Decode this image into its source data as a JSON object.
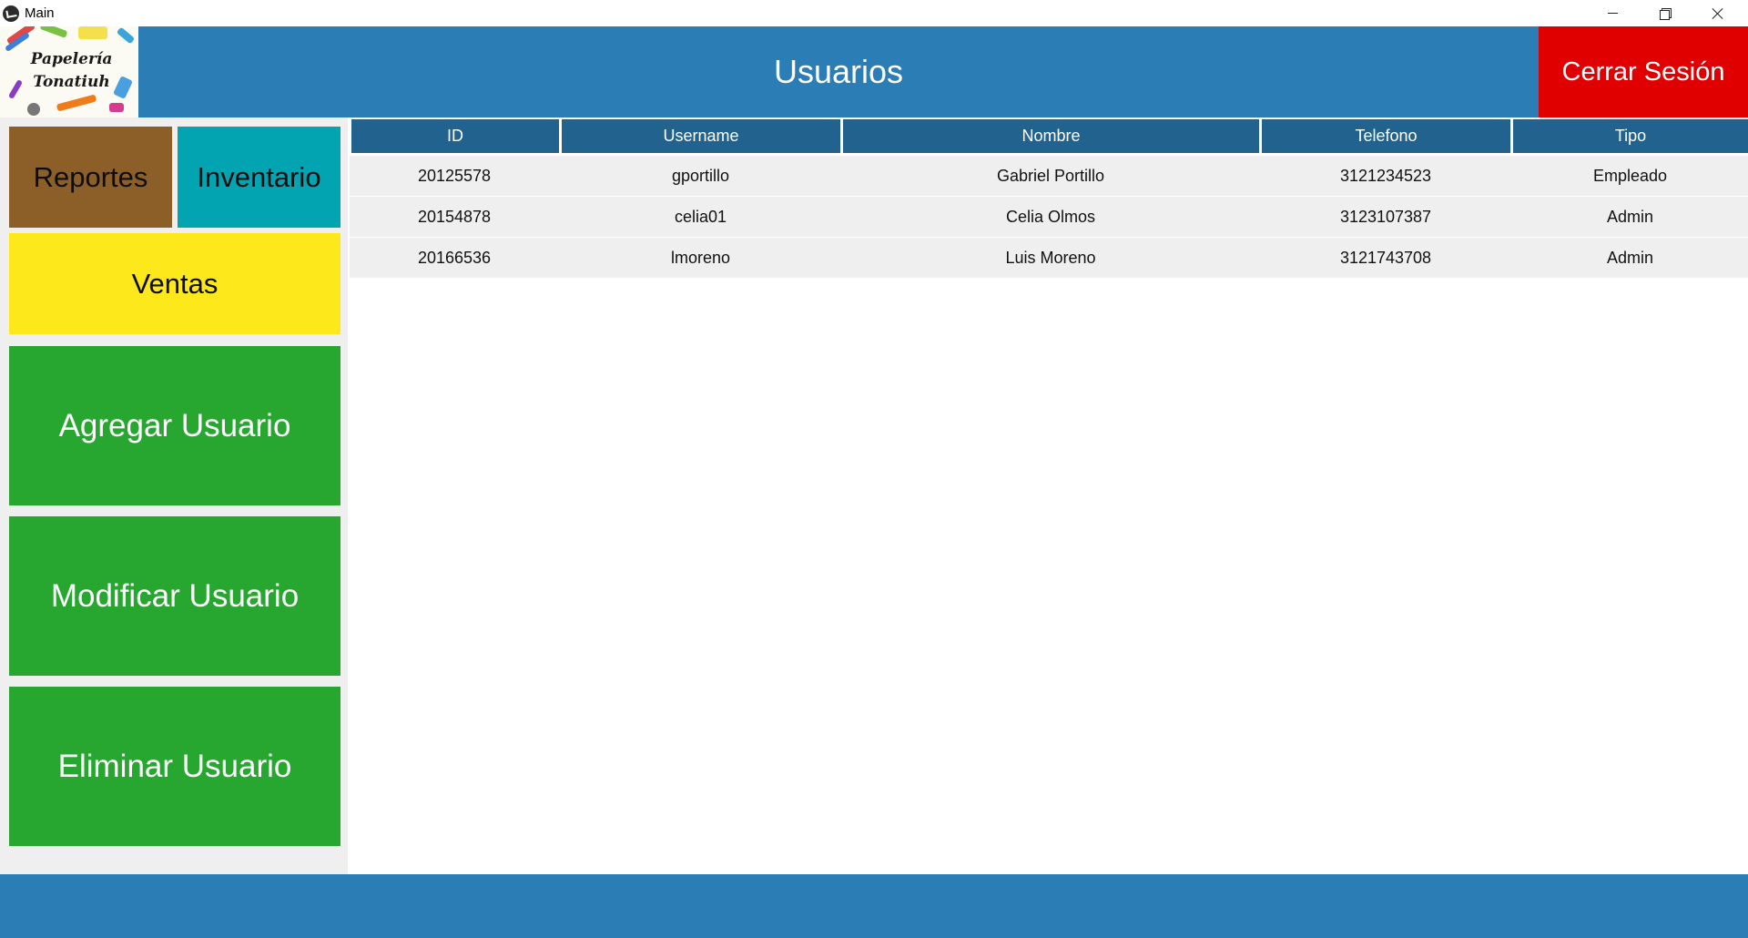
{
  "window": {
    "title": "Main"
  },
  "header": {
    "logo_line1": "Papelería",
    "logo_line2": "Tonatiuh",
    "title": "Usuarios",
    "logout_label": "Cerrar Sesión"
  },
  "sidebar": {
    "reportes": "Reportes",
    "inventario": "Inventario",
    "ventas": "Ventas",
    "agregar": "Agregar Usuario",
    "modificar": "Modificar Usuario",
    "eliminar": "Eliminar Usuario"
  },
  "table": {
    "columns": [
      "ID",
      "Username",
      "Nombre",
      "Telefono",
      "Tipo"
    ],
    "rows": [
      [
        "20125578",
        "gportillo",
        "Gabriel Portillo",
        "3121234523",
        "Empleado"
      ],
      [
        "20154878",
        "celia01",
        "Celia Olmos",
        "3123107387",
        "Admin"
      ],
      [
        "20166536",
        "lmoreno",
        "Luis Moreno",
        "3121743708",
        "Admin"
      ]
    ]
  },
  "colors": {
    "header_blue": "#2a7db5",
    "table_header": "#22628e",
    "logout_red": "#e00000",
    "reportes_brown": "#8c5f29",
    "inventario_teal": "#02a4b1",
    "ventas_yellow": "#fde81b",
    "action_green": "#27a730"
  },
  "icons": {
    "app": "kivy-icon",
    "minimize": "minimize-icon",
    "maximize": "restore-icon",
    "close": "close-icon"
  }
}
